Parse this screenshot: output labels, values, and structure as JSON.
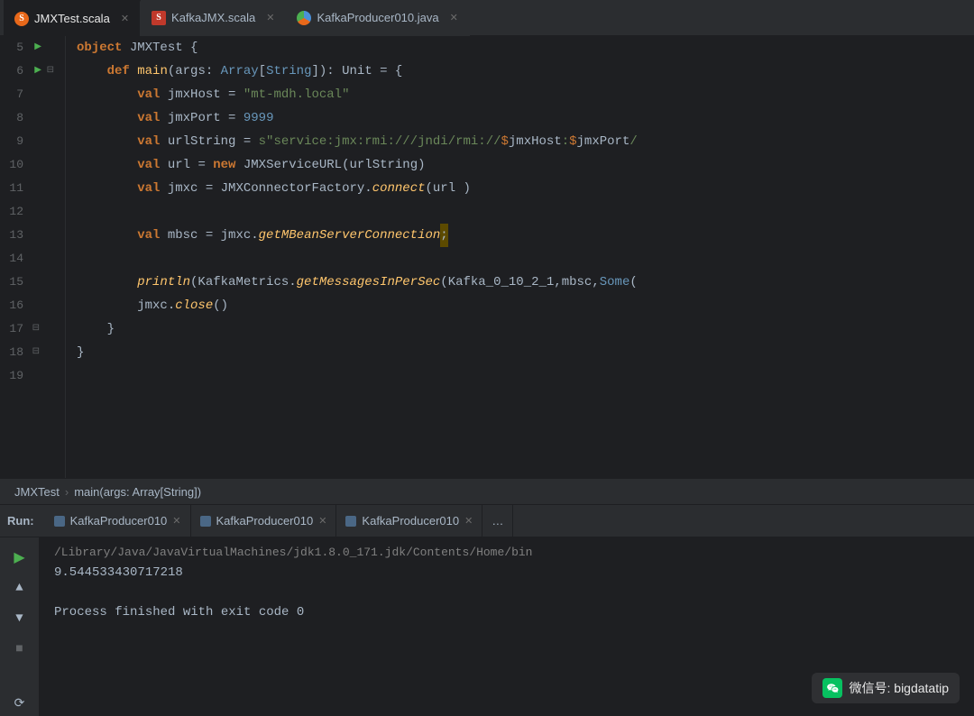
{
  "tabs": [
    {
      "id": "jmxtest",
      "label": "JMXTest.scala",
      "icon": "scala-orange",
      "active": true
    },
    {
      "id": "kafkajmx",
      "label": "KafkaJMX.scala",
      "icon": "scala-red",
      "active": false
    },
    {
      "id": "kafkaproducer",
      "label": "KafkaProducer010.java",
      "icon": "java",
      "active": false
    }
  ],
  "code_lines": [
    {
      "num": 5,
      "run": true,
      "fold": false,
      "content": ""
    },
    {
      "num": 6,
      "run": true,
      "fold": true,
      "content": ""
    },
    {
      "num": 7,
      "run": false,
      "fold": false,
      "content": ""
    },
    {
      "num": 8,
      "run": false,
      "fold": false,
      "content": ""
    },
    {
      "num": 9,
      "run": false,
      "fold": false,
      "content": ""
    },
    {
      "num": 10,
      "run": false,
      "fold": false,
      "content": ""
    },
    {
      "num": 11,
      "run": false,
      "fold": false,
      "content": ""
    },
    {
      "num": 12,
      "run": false,
      "fold": false,
      "content": ""
    },
    {
      "num": 13,
      "run": false,
      "fold": false,
      "content": ""
    },
    {
      "num": 14,
      "run": false,
      "fold": false,
      "content": ""
    },
    {
      "num": 15,
      "run": false,
      "fold": false,
      "content": ""
    },
    {
      "num": 16,
      "run": false,
      "fold": false,
      "content": ""
    },
    {
      "num": 17,
      "run": false,
      "fold": true,
      "content": ""
    },
    {
      "num": 18,
      "run": false,
      "fold": true,
      "content": ""
    },
    {
      "num": 19,
      "run": false,
      "fold": false,
      "content": ""
    }
  ],
  "breadcrumb": {
    "class": "JMXTest",
    "separator": "›",
    "method": "main(args: Array[String])"
  },
  "run_panel": {
    "label": "Run:",
    "tabs": [
      {
        "label": "KafkaProducer010"
      },
      {
        "label": "KafkaProducer010"
      },
      {
        "label": "KafkaProducer010"
      }
    ],
    "output_lines": [
      "/Library/Java/JavaVirtualMachines/jdk1.8.0_171.jdk/Contents/Home/bin",
      "9.544533430717218",
      "",
      "Process finished with exit code 0"
    ]
  },
  "watermark": {
    "icon": "微信",
    "text": "微信号: bigdatatip"
  }
}
